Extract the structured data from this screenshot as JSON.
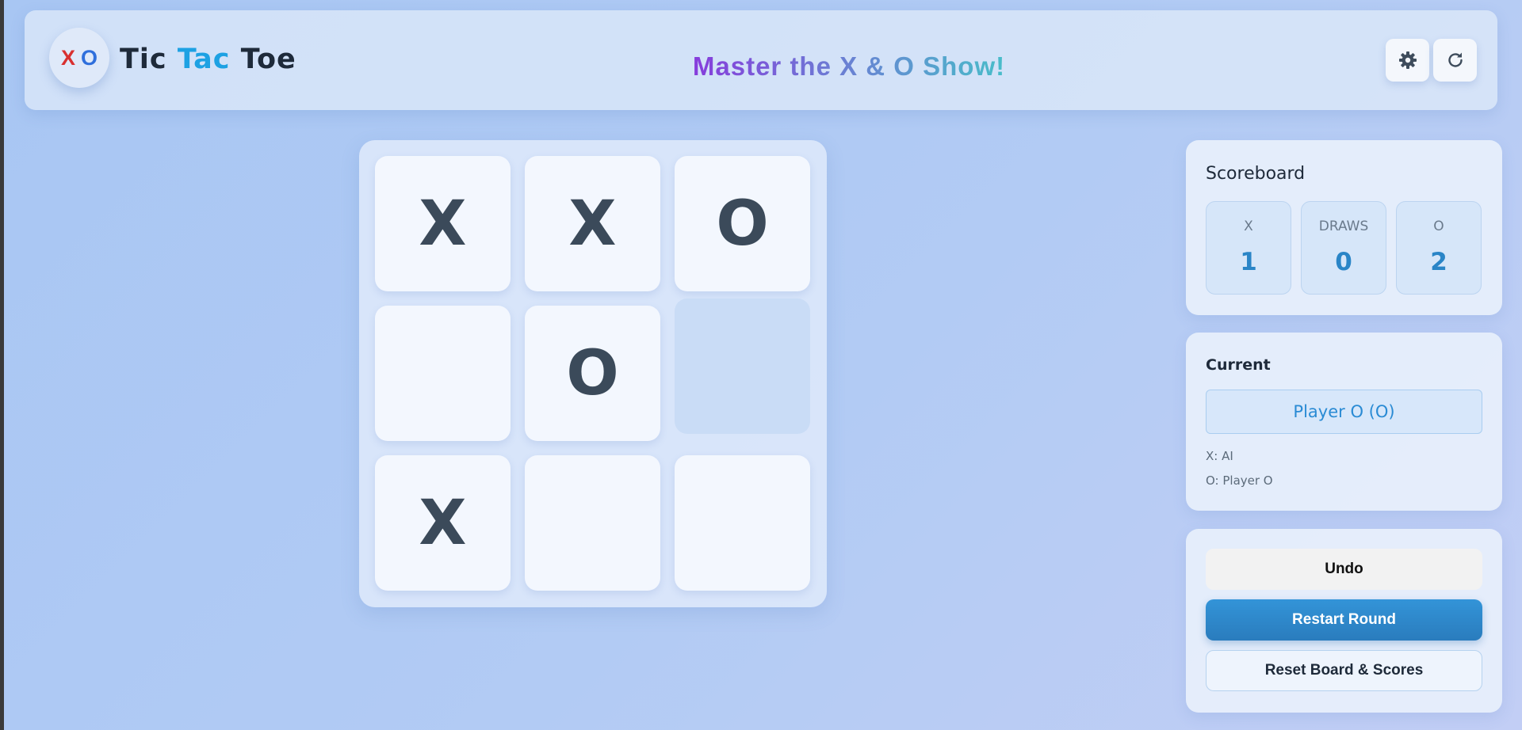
{
  "header": {
    "logo": {
      "x": "X",
      "o": "O"
    },
    "title": {
      "part1": "Tic ",
      "part2": "Tac",
      "part3": " Toe"
    },
    "tagline": "Master the X & O Show!",
    "settings_icon": "gear-icon",
    "restart_icon": "refresh-icon"
  },
  "board": {
    "cells": [
      "X",
      "X",
      "O",
      "",
      "O",
      "",
      "X",
      "",
      ""
    ],
    "hovered_cell": 5
  },
  "scoreboard": {
    "title": "Scoreboard",
    "x": {
      "label": "X",
      "value": "1"
    },
    "draws": {
      "label": "DRAWS",
      "value": "0"
    },
    "o": {
      "label": "O",
      "value": "2"
    }
  },
  "current": {
    "title": "Current",
    "player": "Player O (O)",
    "x_info": "X: AI",
    "o_info": "O: Player O"
  },
  "actions": {
    "undo": "Undo",
    "restart_round": "Restart Round",
    "reset": "Reset Board & Scores"
  },
  "colors": {
    "accent": "#2a85c7",
    "logo_x": "#d83030",
    "logo_o": "#2f6fdc",
    "title_tac": "#1da1e3",
    "primary_button": "#3394d8"
  }
}
